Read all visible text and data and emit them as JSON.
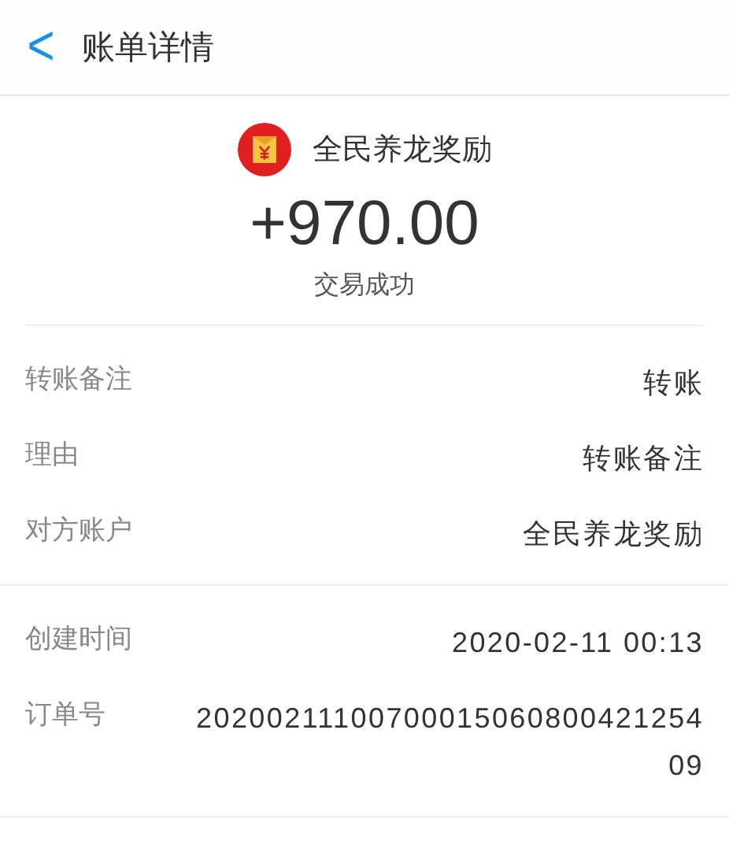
{
  "header": {
    "back": "<",
    "title": "账单详情"
  },
  "summary": {
    "payee": "全民养龙奖励",
    "amount": "+970.00",
    "status": "交易成功"
  },
  "detail_groups": [
    [
      {
        "label": "转账备注",
        "value": "转账"
      },
      {
        "label": "理由",
        "value": "转账备注"
      },
      {
        "label": "对方账户",
        "value": "全民养龙奖励"
      }
    ],
    [
      {
        "label": "创建时间",
        "value": "2020-02-11 00:13"
      },
      {
        "label": "订单号",
        "value": "2020021110070001506080042125409"
      }
    ]
  ]
}
